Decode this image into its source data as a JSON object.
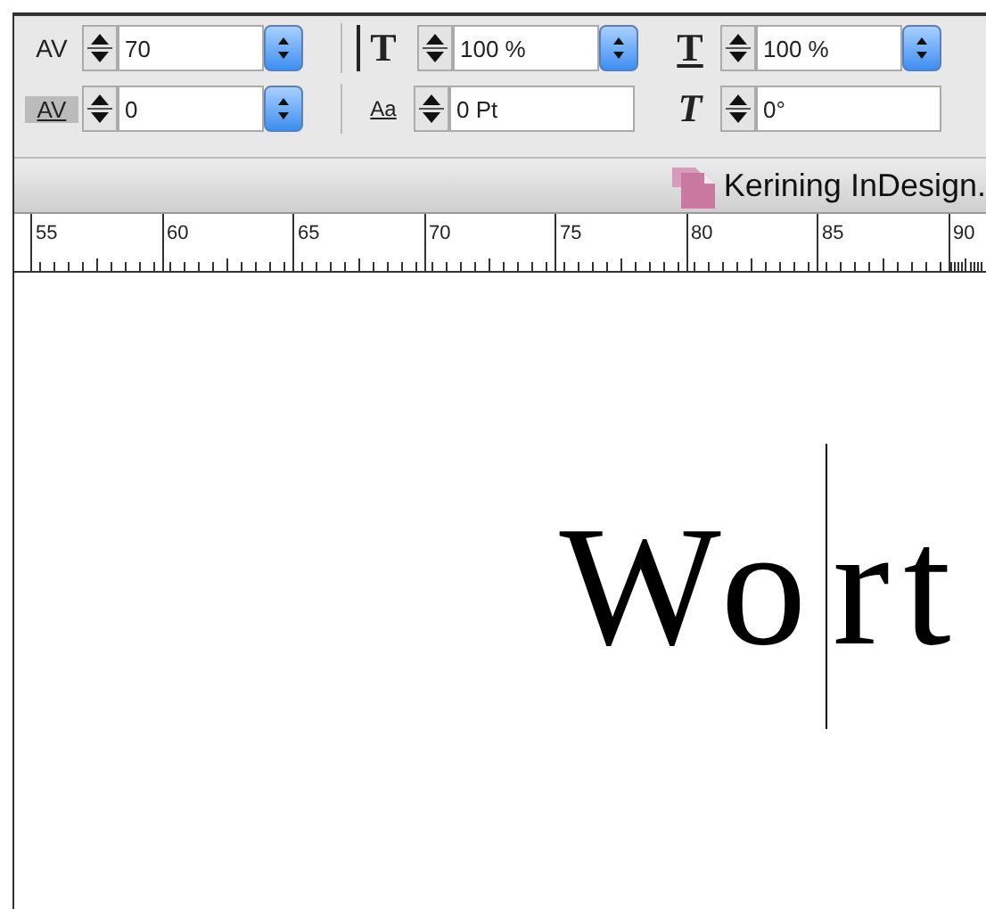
{
  "control_panel": {
    "fields": [
      {
        "kind": "kerning",
        "icon": "AV",
        "value": "70",
        "popup": true
      },
      {
        "kind": "vertical_scale",
        "icon": "T",
        "value": "100 %",
        "popup": true
      },
      {
        "kind": "horizontal_scale",
        "icon": "T",
        "value": "100 %",
        "popup": true
      },
      {
        "kind": "tracking",
        "icon": "AV",
        "value": "0",
        "popup": true
      },
      {
        "kind": "baseline_shift",
        "icon": "Aa",
        "value": "0 Pt",
        "popup": false
      },
      {
        "kind": "skew",
        "icon": "T",
        "value": "0°",
        "popup": false
      }
    ]
  },
  "document_tab": {
    "title": "Kerining InDesign."
  },
  "ruler": {
    "labels": [
      "55",
      "60",
      "65",
      "70",
      "75",
      "80",
      "85",
      "90"
    ]
  },
  "canvas": {
    "text_before_cursor": "Wo",
    "text_after_cursor": "rt"
  }
}
